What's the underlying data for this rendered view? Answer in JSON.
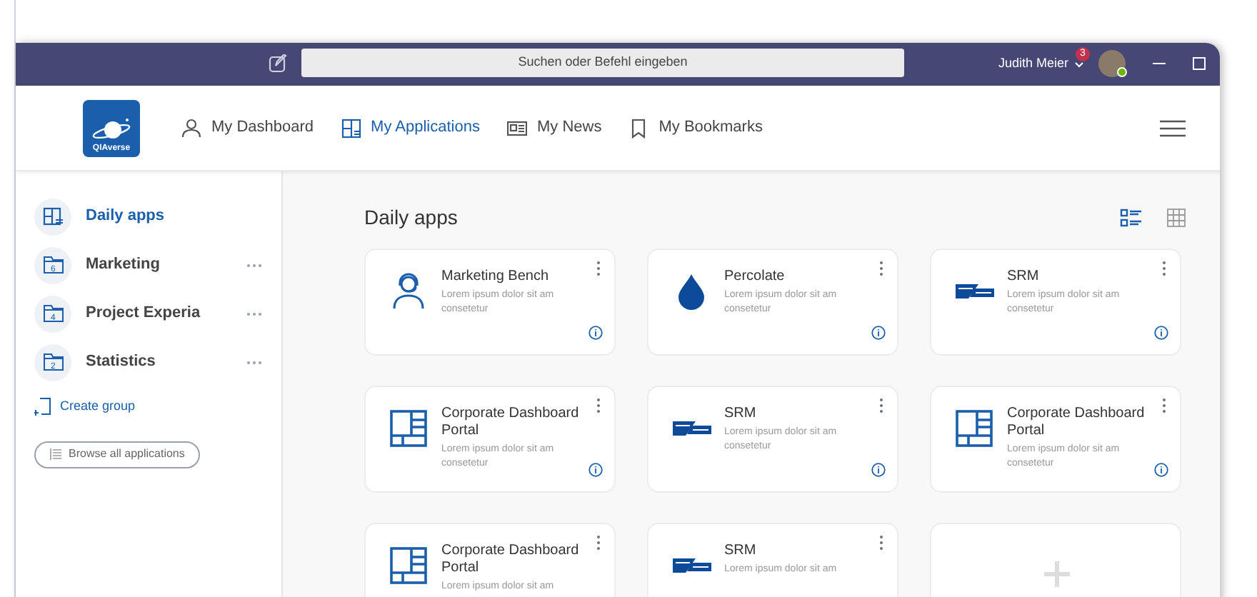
{
  "titlebar": {
    "search_placeholder": "Suchen oder Befehl eingeben",
    "user_name": "Judith Meier",
    "notification_count": "3"
  },
  "header": {
    "logo_text": "QIAverse",
    "nav": [
      {
        "label": "My Dashboard",
        "kind": "person",
        "selected": false
      },
      {
        "label": "My Applications",
        "kind": "apps",
        "selected": true
      },
      {
        "label": "My News",
        "kind": "news",
        "selected": false
      },
      {
        "label": "My Bookmarks",
        "kind": "bookmark",
        "selected": false
      }
    ]
  },
  "sidebar": {
    "items": [
      {
        "label": "Daily apps",
        "kind": "apps",
        "selected": true
      },
      {
        "label": "Marketing",
        "kind": "folder",
        "count": "6",
        "selected": false
      },
      {
        "label": "Project Experia",
        "kind": "folder",
        "count": "4",
        "selected": false
      },
      {
        "label": "Statistics",
        "kind": "folder",
        "count": "2",
        "selected": false
      }
    ],
    "create_group": "Create group",
    "browse_button": "Browse all applications"
  },
  "content": {
    "title": "Daily apps",
    "view_modes": [
      {
        "kind": "list",
        "selected": true
      },
      {
        "kind": "grid",
        "selected": false
      }
    ],
    "cards": [
      {
        "kind": "headset",
        "title": "Marketing Bench",
        "description": "Lorem ipsum dolor sit am consetetur"
      },
      {
        "kind": "drop",
        "title": "Percolate",
        "description": "Lorem ipsum dolor sit am consetetur"
      },
      {
        "kind": "sap",
        "title": "SRM",
        "description": "Lorem ipsum dolor sit am consetetur"
      },
      {
        "kind": "dashboard",
        "title": "Corporate Dashboard Portal",
        "description": "Lorem ipsum dolor sit am consetetur"
      },
      {
        "kind": "sap",
        "title": "SRM",
        "description": "Lorem ipsum dolor sit am consetetur"
      },
      {
        "kind": "dashboard",
        "title": "Corporate Dashboard Portal",
        "description": "Lorem ipsum dolor sit am consetetur"
      },
      {
        "kind": "dashboard",
        "title": "Corporate Dashboard Portal",
        "description": "Lorem ipsum dolor sit am"
      },
      {
        "kind": "sap",
        "title": "SRM",
        "description": "Lorem ipsum dolor sit am"
      },
      {
        "kind": "add"
      }
    ]
  }
}
